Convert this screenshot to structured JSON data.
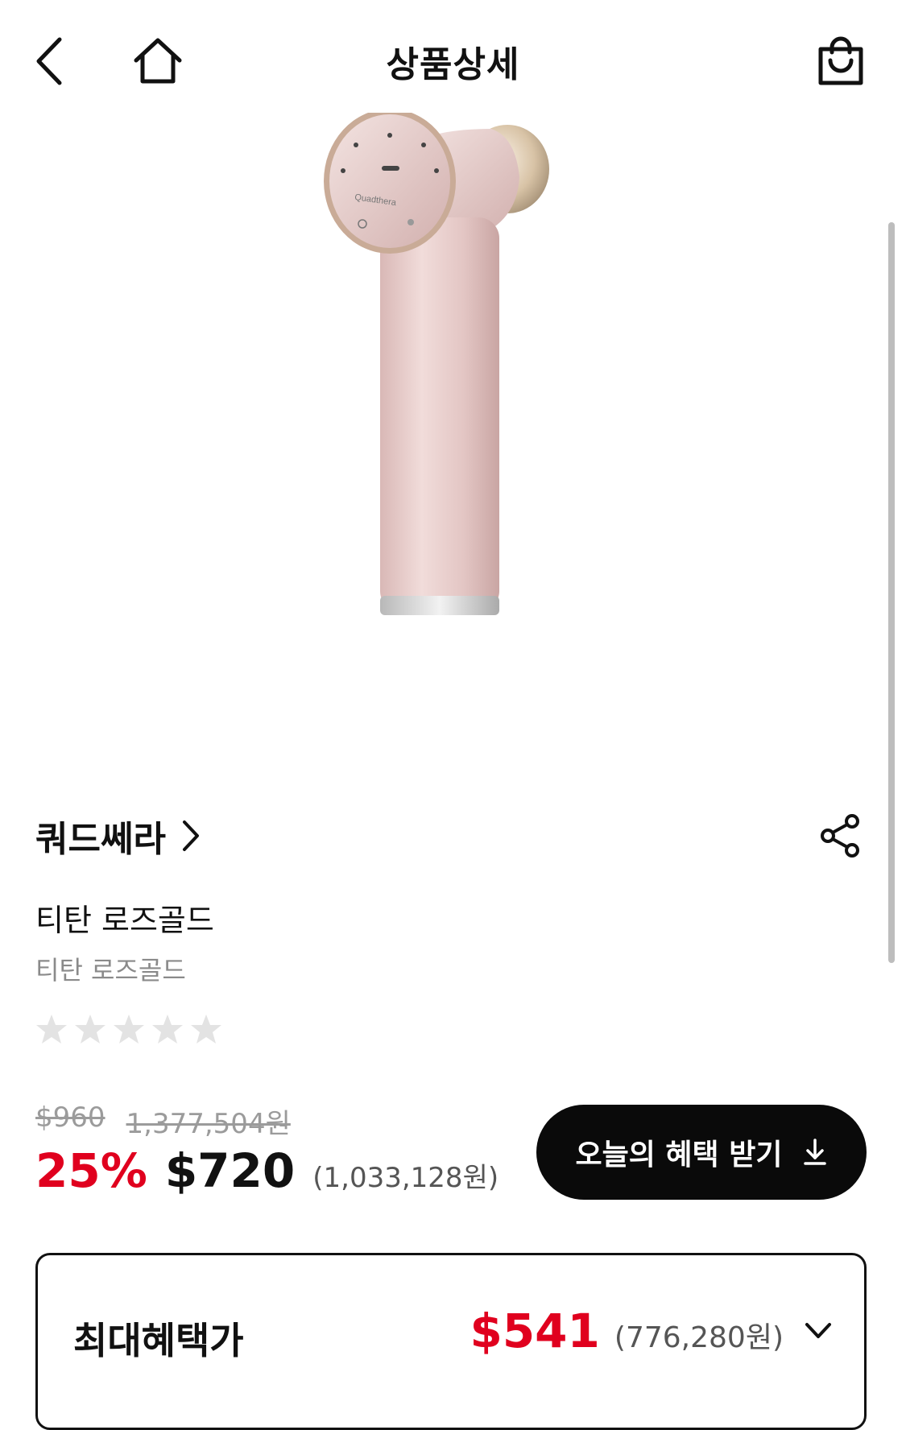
{
  "header": {
    "title": "상품상세",
    "back_icon": "chevron-left-icon",
    "home_icon": "home-icon",
    "cart_icon": "shopping-bag-icon"
  },
  "product": {
    "brand": "쿼드쎄라",
    "name": "티탄 로즈골드",
    "option": "티탄 로즈골드",
    "rating_stars": 0,
    "rating_max": 5,
    "image_logo_text": "Quadthera"
  },
  "pricing": {
    "original_usd": "$960",
    "original_krw": "1,377,504원",
    "discount": "25%",
    "price_usd": "$720",
    "price_krw": "(1,033,128원)",
    "benefit_button": "오늘의 혜택 받기"
  },
  "max_benefit": {
    "label": "최대혜택가",
    "price_usd": "$541",
    "price_krw": "(776,280원)"
  },
  "colors": {
    "accent_red": "#e0001e",
    "button_black": "#0a0a0a",
    "muted_gray": "#9b9b9b"
  }
}
